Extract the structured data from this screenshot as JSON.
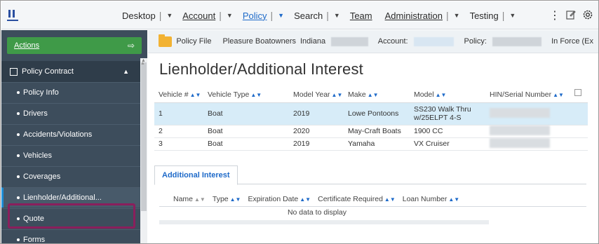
{
  "nav": {
    "items": [
      {
        "label": "Desktop",
        "active": false
      },
      {
        "label": "Account",
        "active": false
      },
      {
        "label": "Policy",
        "active": true
      },
      {
        "label": "Search",
        "active": false
      },
      {
        "label": "Team",
        "active": false
      },
      {
        "label": "Administration",
        "active": false
      },
      {
        "label": "Testing",
        "active": false
      }
    ],
    "icons": [
      "menu-dots-icon",
      "edit-icon",
      "settings-icon"
    ]
  },
  "sidebar": {
    "actions_label": "Actions",
    "group_label": "Policy Contract",
    "items": [
      {
        "label": "Policy Info"
      },
      {
        "label": "Drivers"
      },
      {
        "label": "Accidents/Violations"
      },
      {
        "label": "Vehicles"
      },
      {
        "label": "Coverages"
      },
      {
        "label": "Lienholder/Additional..."
      },
      {
        "label": "Quote"
      },
      {
        "label": "Forms"
      }
    ]
  },
  "infobar": {
    "policy_file": "Policy File",
    "product": "Pleasure Boatowners",
    "state": "Indiana",
    "account_label": "Account:",
    "policy_label": "Policy:",
    "status": "In Force (Ex"
  },
  "page": {
    "title": "Lienholder/Additional Interest"
  },
  "vehicles": {
    "columns": [
      "Vehicle #",
      "Vehicle Type",
      "Model Year",
      "Make",
      "Model",
      "HIN/Serial Number"
    ],
    "rows": [
      {
        "num": "1",
        "type": "Boat",
        "year": "2019",
        "make": "Lowe Pontoons",
        "model": "SS230 Walk Thru w/25ELPT 4-S"
      },
      {
        "num": "2",
        "type": "Boat",
        "year": "2020",
        "make": "May-Craft Boats",
        "model": "1900 CC"
      },
      {
        "num": "3",
        "type": "Boat",
        "year": "2019",
        "make": "Yamaha",
        "model": "VX Cruiser"
      }
    ]
  },
  "additional_interest": {
    "tab_label": "Additional Interest",
    "columns": [
      "Name",
      "Type",
      "Expiration Date",
      "Certificate Required",
      "Loan Number"
    ],
    "empty_text": "No data to display"
  },
  "colors": {
    "accent": "#1e6ac9",
    "actions_green": "#3f9a48",
    "sidebar_bg": "#3d4d5c",
    "highlight": "#8a1f5c",
    "selected_row": "#d7ecf8"
  }
}
